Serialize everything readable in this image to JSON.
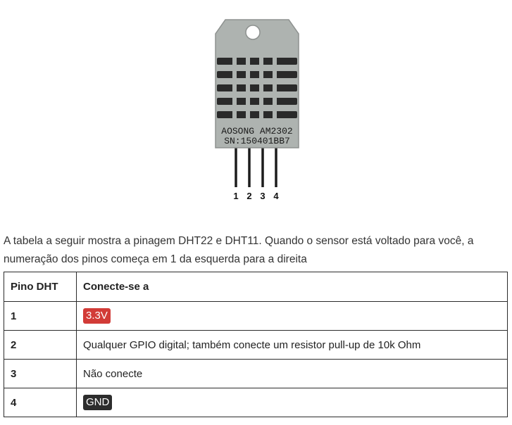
{
  "figure": {
    "sensor_label_line1": "AOSONG AM2302",
    "sensor_label_line2": "SN:150401BB7",
    "pin_numbers": [
      "1",
      "2",
      "3",
      "4"
    ]
  },
  "intro_text": "A tabela a seguir mostra a pinagem DHT22 e DHT11. Quando o sensor está voltado para você, a numeração dos pinos começa em 1 da esquerda para a direita",
  "table": {
    "headers": [
      "Pino DHT",
      "Conecte-se a"
    ],
    "rows": [
      {
        "pin": "1",
        "connect": "3.3V",
        "badge": "red"
      },
      {
        "pin": "2",
        "connect": "Qualquer GPIO digital; também conecte um resistor pull-up de 10k Ohm",
        "badge": ""
      },
      {
        "pin": "3",
        "connect": "Não conecte",
        "badge": ""
      },
      {
        "pin": "4",
        "connect": "GND",
        "badge": "dark"
      }
    ]
  },
  "colors": {
    "body_color": "#aeb3b0",
    "badge_red": "#d23b37",
    "badge_dark": "#2d2d2d"
  }
}
